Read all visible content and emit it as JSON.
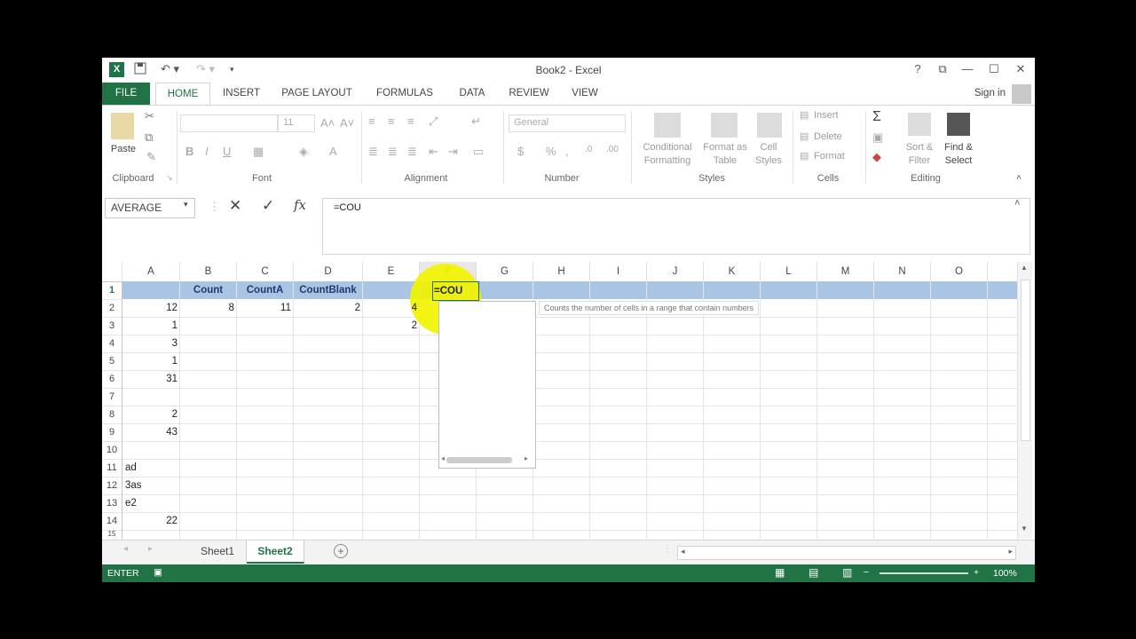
{
  "window": {
    "title": "Book2 - Excel"
  },
  "window_controls": {
    "help": "?",
    "restore": "⧉",
    "minimize": "—",
    "maximize": "☐",
    "close": "✕"
  },
  "tabs": [
    "FILE",
    "HOME",
    "INSERT",
    "PAGE LAYOUT",
    "FORMULAS",
    "DATA",
    "REVIEW",
    "VIEW"
  ],
  "account": {
    "sign_in": "Sign in"
  },
  "ribbon": {
    "clipboard": {
      "label": "Clipboard",
      "paste": "Paste"
    },
    "font": {
      "label": "Font",
      "size": "11",
      "bold": "B",
      "italic": "I",
      "underline": "U"
    },
    "alignment": {
      "label": "Alignment"
    },
    "number": {
      "label": "Number",
      "format": "General",
      "currency": "$",
      "percent": "%"
    },
    "styles": {
      "label": "Styles",
      "conditional": "Conditional\nFormatting",
      "format_table": "Format as\nTable",
      "cell_styles": "Cell\nStyles"
    },
    "cells": {
      "label": "Cells",
      "insert": "Insert",
      "delete": "Delete",
      "format": "Format"
    },
    "editing": {
      "label": "Editing",
      "sort": "Sort &\nFilter",
      "find": "Find &\nSelect"
    }
  },
  "formula_bar": {
    "name_box": "AVERAGE",
    "formula": "=COU",
    "cancel": "✕",
    "enter": "✓",
    "fx": "fx"
  },
  "columns": [
    "A",
    "B",
    "C",
    "D",
    "E",
    "F",
    "G",
    "H",
    "I",
    "J",
    "K",
    "L",
    "M",
    "N",
    "O"
  ],
  "rows": [
    "1",
    "2",
    "3",
    "4",
    "5",
    "6",
    "7",
    "8",
    "9",
    "10",
    "11",
    "12",
    "13",
    "14",
    "15"
  ],
  "cells": {
    "B1": "Count",
    "C1": "CountA",
    "D1": "CountBlank",
    "F1": "=COU",
    "A2": "12",
    "B2": "8",
    "C2": "11",
    "D2": "2",
    "E2": "4",
    "A3": "1",
    "E3": "2",
    "A4": "3",
    "A5": "1",
    "A6": "31",
    "A8": "2",
    "A9": "43",
    "A11": "ad",
    "A12": "3as",
    "A13": "e2",
    "A14": "22"
  },
  "autocomplete": {
    "tooltip": "Counts the number of cells in a range that contain numbers"
  },
  "sheets": {
    "items": [
      "Sheet1",
      "Sheet2"
    ],
    "active": "Sheet2"
  },
  "status": {
    "mode": "ENTER",
    "zoom": "100%"
  },
  "colors": {
    "excel_green": "#217346",
    "row_highlight": "#a9c4e4",
    "cursor_highlight": "#f2f200"
  }
}
